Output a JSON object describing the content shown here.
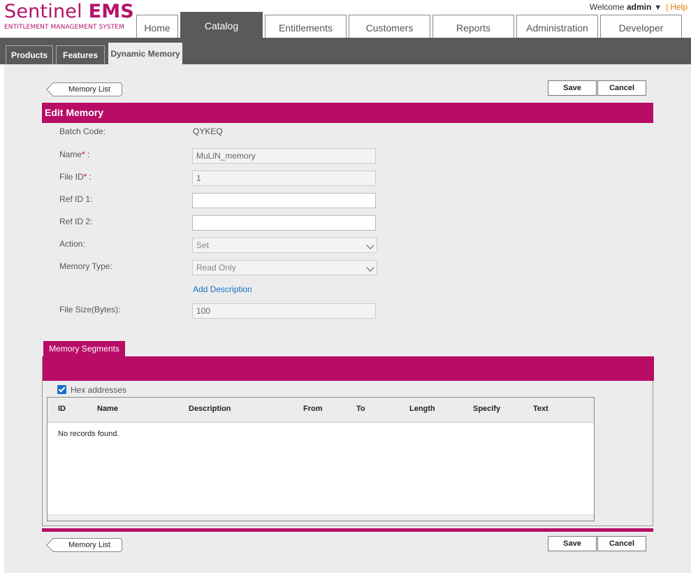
{
  "brand": {
    "name_light": "Sentinel",
    "name_bold": "EMS",
    "subtitle": "ENTITLEMENT MANAGEMENT SYSTEM"
  },
  "user": {
    "welcome": "Welcome",
    "username": "admin",
    "separator": "|",
    "help": "Help"
  },
  "main_tabs": [
    {
      "label": "Home",
      "active": false
    },
    {
      "label": "Catalog",
      "active": true
    },
    {
      "label": "Entitlements",
      "active": false
    },
    {
      "label": "Customers",
      "active": false
    },
    {
      "label": "Reports",
      "active": false
    },
    {
      "label": "Administration",
      "active": false
    },
    {
      "label": "Developer",
      "active": false
    }
  ],
  "sub_tabs": [
    {
      "label": "Products",
      "active": false
    },
    {
      "label": "Features",
      "active": false
    },
    {
      "label": "Dynamic Memory",
      "active": true
    }
  ],
  "actions": {
    "back": "Memory List",
    "save": "Save",
    "cancel": "Cancel"
  },
  "form": {
    "title": "Edit Memory",
    "batch_code": {
      "label": "Batch Code:",
      "value": "QYKEQ"
    },
    "name": {
      "label": "Name",
      "suffix": " :",
      "value": "MuLiN_memory"
    },
    "file_id": {
      "label": "File ID",
      "suffix": " :",
      "value": "1"
    },
    "ref_id_1": {
      "label": "Ref ID 1:",
      "value": ""
    },
    "ref_id_2": {
      "label": "Ref ID 2:",
      "value": ""
    },
    "action": {
      "label": "Action:",
      "value": "Set"
    },
    "memory_type": {
      "label": "Memory Type:",
      "value": "Read Only"
    },
    "add_description": "Add Description",
    "file_size": {
      "label": "File Size(Bytes):",
      "value": "100"
    },
    "required_mark": "*"
  },
  "segments": {
    "tab": "Memory Segments",
    "hex_label": "Hex addresses",
    "hex_checked": true,
    "columns": [
      "ID",
      "Name",
      "Description",
      "From",
      "To",
      "Length",
      "Specify",
      "Text"
    ],
    "empty": "No records found."
  },
  "colors": {
    "brand": "#b80c67",
    "nav": "#5a5a5a",
    "link": "#1a6fc9",
    "help": "#e07b00"
  }
}
